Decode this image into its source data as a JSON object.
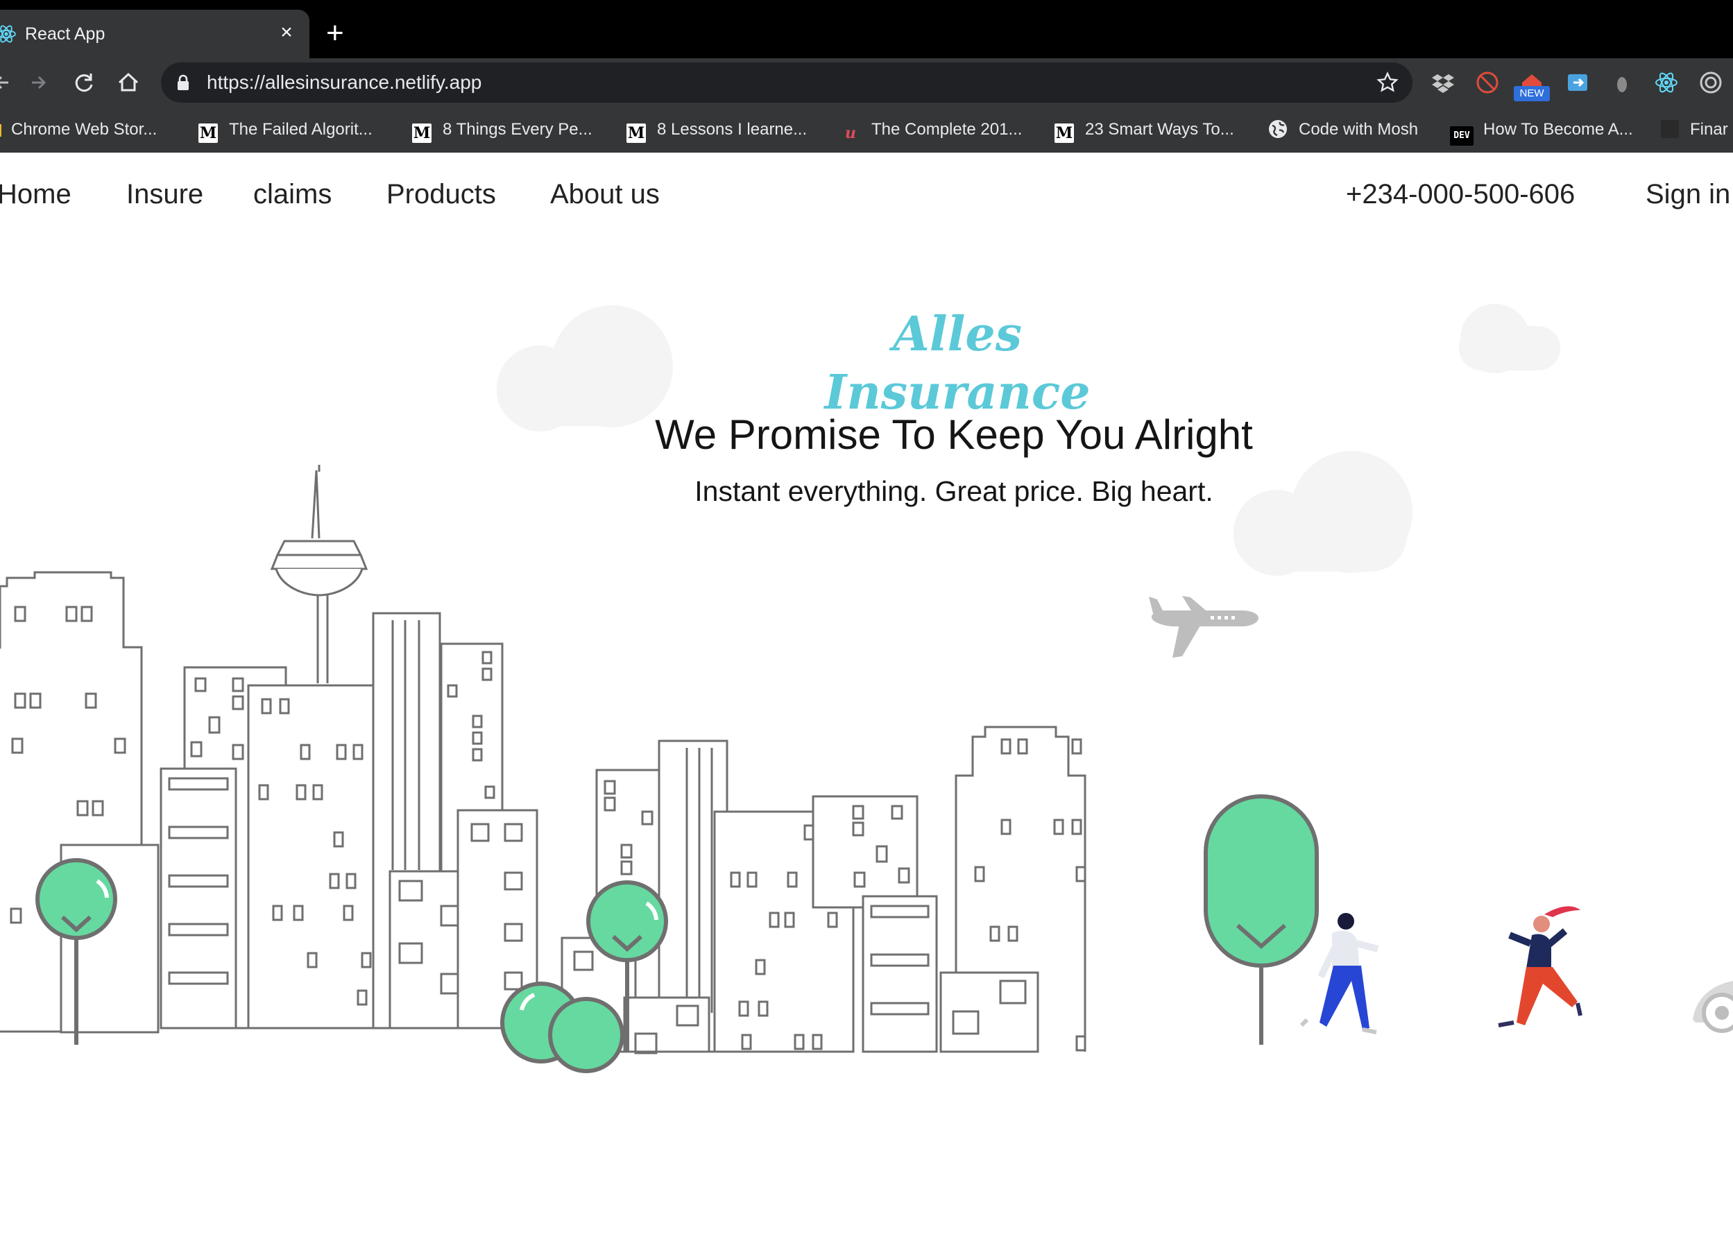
{
  "browser": {
    "tab_title": "React App",
    "tab_close": "×",
    "new_tab": "+",
    "url": "https://allesinsurance.netlify.app",
    "extension_badge": "NEW",
    "bookmarks": [
      {
        "label": "Chrome Web Stor...",
        "icon": ""
      },
      {
        "label": "The Failed Algorit...",
        "icon": "M"
      },
      {
        "label": "8 Things Every Pe...",
        "icon": "M"
      },
      {
        "label": "8 Lessons I learne...",
        "icon": "M"
      },
      {
        "label": "The Complete 201...",
        "icon": "u"
      },
      {
        "label": "23 Smart Ways To...",
        "icon": "M"
      },
      {
        "label": "Code with Mosh",
        "icon": "globe"
      },
      {
        "label": "How To Become A...",
        "icon": "DEV"
      },
      {
        "label": "Finar",
        "icon": ""
      }
    ]
  },
  "nav": {
    "home": "Home",
    "insure": "Insure",
    "claims": "claims",
    "products": "Products",
    "about": "About us",
    "phone": "+234-000-500-606",
    "signin": "Sign in"
  },
  "hero": {
    "logo": "Alles Insurance",
    "headline": "We Promise To Keep You Alright",
    "tagline": "Instant everything. Great price. Big heart."
  },
  "colors": {
    "brand": "#5bc9d8",
    "tree": "#66d9a0",
    "chrome_dark": "#353638",
    "tab_strip": "#000000"
  }
}
